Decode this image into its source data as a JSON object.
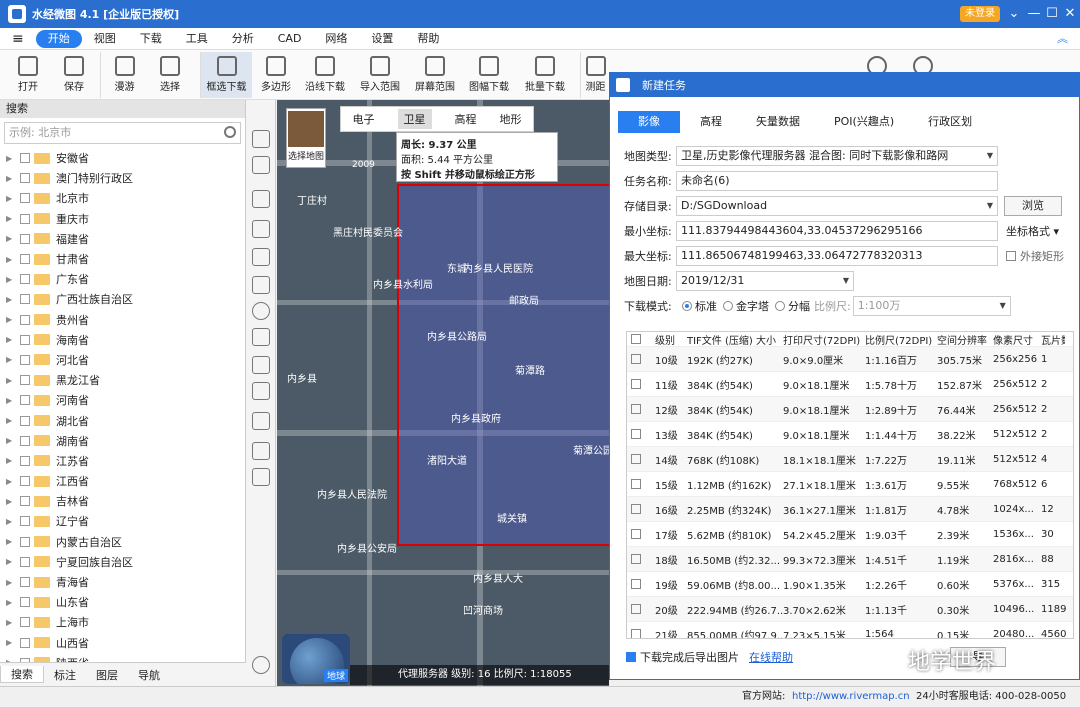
{
  "app": {
    "title": "水经微图 4.1 [企业版已授权]",
    "login_badge": "未登录",
    "window_controls": [
      "⌄",
      "—",
      "☐",
      "✕"
    ]
  },
  "menu": [
    "开始",
    "视图",
    "下载",
    "工具",
    "分析",
    "CAD",
    "网络",
    "设置",
    "帮助"
  ],
  "toolbar": [
    "打开",
    "保存",
    "漫游",
    "选择",
    "框选下载",
    "多边形",
    "沿线下载",
    "导入范围",
    "屏幕范围",
    "图幅下载",
    "批量下载",
    "测距"
  ],
  "sidebar": {
    "header": "搜索",
    "search_placeholder": "示例: 北京市",
    "provinces": [
      "安徽省",
      "澳门特别行政区",
      "北京市",
      "重庆市",
      "福建省",
      "甘肃省",
      "广东省",
      "广西壮族自治区",
      "贵州省",
      "海南省",
      "河北省",
      "黑龙江省",
      "河南省",
      "湖北省",
      "湖南省",
      "江苏省",
      "江西省",
      "吉林省",
      "辽宁省",
      "内蒙古自治区",
      "宁夏回族自治区",
      "青海省",
      "山东省",
      "上海市",
      "山西省",
      "陕西省"
    ],
    "tabs": [
      "搜索",
      "标注",
      "图层",
      "导航"
    ]
  },
  "map": {
    "layer_label": "选择地图",
    "tabs": [
      "电子",
      "卫星",
      "高程",
      "地形"
    ],
    "year_label": "2009",
    "perimeter": "周长: 9.37 公里",
    "area": "面积: 5.44 平方公里",
    "hint": "按 Shift 并移动鼠标绘正方形",
    "labels": [
      "内乡县",
      "丁庄村",
      "黑庄村民委员会",
      "内乡县人民医院",
      "东城",
      "内乡县公路局",
      "内乡县水利局",
      "内乡县政府",
      "菊潭公园",
      "内乡县人民法院",
      "内乡县人大",
      "城关镇",
      "渚阳大道",
      "菊潭路",
      "邮政局",
      "凹河商场",
      "内乡县公安局"
    ],
    "globe_label": "地球",
    "status": "代理服务器  级别:  16  比例尺: 1:18055"
  },
  "dialog": {
    "title": "新建任务",
    "tabs": [
      "影像",
      "高程",
      "矢量数据",
      "POI(兴趣点)",
      "行政区划"
    ],
    "map_type_label": "地图类型:",
    "map_type_value": "卫星,历史影像代理服务器  混合图: 同时下载影像和路网",
    "task_name_label": "任务名称:",
    "task_name_value": "未命名(6)",
    "save_dir_label": "存储目录:",
    "save_dir_value": "D:/SGDownload",
    "browse": "浏览",
    "min_coord_label": "最小坐标:",
    "min_coord_value": "111.83794498443604,33.04537296295166",
    "coord_format": "坐标格式 ▾",
    "max_coord_label": "最大坐标:",
    "max_coord_value": "111.86506748199463,33.06472778320313",
    "outer_rect": "外接矩形",
    "map_date_label": "地图日期:",
    "map_date_value": "2019/12/31",
    "mode_label": "下载模式:",
    "modes": [
      "标准",
      "金字塔",
      "分幅"
    ],
    "scale_label": "比例尺:",
    "scale_value": "1:100万",
    "columns": [
      "级别",
      "TIF文件 (压缩) 大小",
      "打印尺寸(72DPI)",
      "比例尺(72DPI)",
      "空间分辨率",
      "像素尺寸",
      "瓦片数"
    ],
    "levels": [
      [
        "10级",
        "192K (约27K)",
        "9.0×9.0厘米",
        "1:1.16百万",
        "305.75米",
        "256x256",
        "1"
      ],
      [
        "11级",
        "384K (约54K)",
        "9.0×18.1厘米",
        "1:5.78十万",
        "152.87米",
        "256x512",
        "2"
      ],
      [
        "12级",
        "384K (约54K)",
        "9.0×18.1厘米",
        "1:2.89十万",
        "76.44米",
        "256x512",
        "2"
      ],
      [
        "13级",
        "384K (约54K)",
        "9.0×18.1厘米",
        "1:1.44十万",
        "38.22米",
        "512x512",
        "2"
      ],
      [
        "14级",
        "768K (约108K)",
        "18.1×18.1厘米",
        "1:7.22万",
        "19.11米",
        "512x512",
        "4"
      ],
      [
        "15级",
        "1.12MB (约162K)",
        "27.1×18.1厘米",
        "1:3.61万",
        "9.55米",
        "768x512",
        "6"
      ],
      [
        "16级",
        "2.25MB (约324K)",
        "36.1×27.1厘米",
        "1:1.81万",
        "4.78米",
        "1024x...",
        "12"
      ],
      [
        "17级",
        "5.62MB (约810K)",
        "54.2×45.2厘米",
        "1:9.03千",
        "2.39米",
        "1536x...",
        "30"
      ],
      [
        "18级",
        "16.50MB (约2.32...",
        "99.3×72.3厘米",
        "1:4.51千",
        "1.19米",
        "2816x...",
        "88"
      ],
      [
        "19级",
        "59.06MB (约8.00...",
        "1.90×1.35米",
        "1:2.26千",
        "0.60米",
        "5376x...",
        "315"
      ],
      [
        "20级",
        "222.94MB (约26.7...",
        "3.70×2.62米",
        "1:1.13千",
        "0.30米",
        "10496...",
        "1189"
      ],
      [
        "21级",
        "855.00MB (约97.9...",
        "7.23×5.15米",
        "1:564",
        "0.15米",
        "20480...",
        "4560"
      ]
    ],
    "export_after": "下载完成后导出图片",
    "online_help": "在线帮助",
    "ok_button": "导"
  },
  "statusbar": {
    "site_label": "官方网站:",
    "site": "http://www.rivermap.cn",
    "phone": "24小时客服电话: 400-028-0050"
  },
  "watermark": "地学世界"
}
